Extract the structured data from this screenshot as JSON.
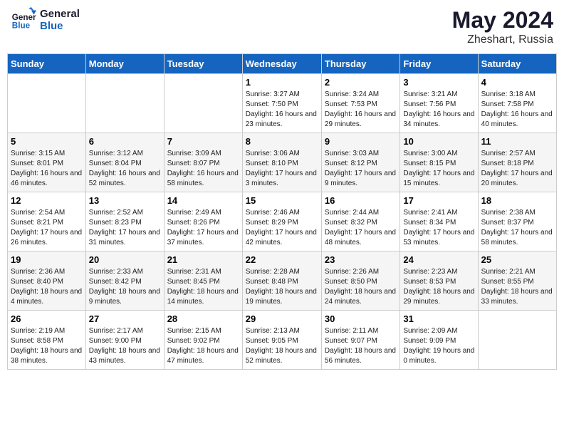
{
  "header": {
    "logo_line1": "General",
    "logo_line2": "Blue",
    "month": "May 2024",
    "location": "Zheshart, Russia"
  },
  "weekdays": [
    "Sunday",
    "Monday",
    "Tuesday",
    "Wednesday",
    "Thursday",
    "Friday",
    "Saturday"
  ],
  "weeks": [
    [
      {
        "day": "",
        "sunrise": "",
        "sunset": "",
        "daylight": ""
      },
      {
        "day": "",
        "sunrise": "",
        "sunset": "",
        "daylight": ""
      },
      {
        "day": "",
        "sunrise": "",
        "sunset": "",
        "daylight": ""
      },
      {
        "day": "1",
        "sunrise": "Sunrise: 3:27 AM",
        "sunset": "Sunset: 7:50 PM",
        "daylight": "Daylight: 16 hours and 23 minutes."
      },
      {
        "day": "2",
        "sunrise": "Sunrise: 3:24 AM",
        "sunset": "Sunset: 7:53 PM",
        "daylight": "Daylight: 16 hours and 29 minutes."
      },
      {
        "day": "3",
        "sunrise": "Sunrise: 3:21 AM",
        "sunset": "Sunset: 7:56 PM",
        "daylight": "Daylight: 16 hours and 34 minutes."
      },
      {
        "day": "4",
        "sunrise": "Sunrise: 3:18 AM",
        "sunset": "Sunset: 7:58 PM",
        "daylight": "Daylight: 16 hours and 40 minutes."
      }
    ],
    [
      {
        "day": "5",
        "sunrise": "Sunrise: 3:15 AM",
        "sunset": "Sunset: 8:01 PM",
        "daylight": "Daylight: 16 hours and 46 minutes."
      },
      {
        "day": "6",
        "sunrise": "Sunrise: 3:12 AM",
        "sunset": "Sunset: 8:04 PM",
        "daylight": "Daylight: 16 hours and 52 minutes."
      },
      {
        "day": "7",
        "sunrise": "Sunrise: 3:09 AM",
        "sunset": "Sunset: 8:07 PM",
        "daylight": "Daylight: 16 hours and 58 minutes."
      },
      {
        "day": "8",
        "sunrise": "Sunrise: 3:06 AM",
        "sunset": "Sunset: 8:10 PM",
        "daylight": "Daylight: 17 hours and 3 minutes."
      },
      {
        "day": "9",
        "sunrise": "Sunrise: 3:03 AM",
        "sunset": "Sunset: 8:12 PM",
        "daylight": "Daylight: 17 hours and 9 minutes."
      },
      {
        "day": "10",
        "sunrise": "Sunrise: 3:00 AM",
        "sunset": "Sunset: 8:15 PM",
        "daylight": "Daylight: 17 hours and 15 minutes."
      },
      {
        "day": "11",
        "sunrise": "Sunrise: 2:57 AM",
        "sunset": "Sunset: 8:18 PM",
        "daylight": "Daylight: 17 hours and 20 minutes."
      }
    ],
    [
      {
        "day": "12",
        "sunrise": "Sunrise: 2:54 AM",
        "sunset": "Sunset: 8:21 PM",
        "daylight": "Daylight: 17 hours and 26 minutes."
      },
      {
        "day": "13",
        "sunrise": "Sunrise: 2:52 AM",
        "sunset": "Sunset: 8:23 PM",
        "daylight": "Daylight: 17 hours and 31 minutes."
      },
      {
        "day": "14",
        "sunrise": "Sunrise: 2:49 AM",
        "sunset": "Sunset: 8:26 PM",
        "daylight": "Daylight: 17 hours and 37 minutes."
      },
      {
        "day": "15",
        "sunrise": "Sunrise: 2:46 AM",
        "sunset": "Sunset: 8:29 PM",
        "daylight": "Daylight: 17 hours and 42 minutes."
      },
      {
        "day": "16",
        "sunrise": "Sunrise: 2:44 AM",
        "sunset": "Sunset: 8:32 PM",
        "daylight": "Daylight: 17 hours and 48 minutes."
      },
      {
        "day": "17",
        "sunrise": "Sunrise: 2:41 AM",
        "sunset": "Sunset: 8:34 PM",
        "daylight": "Daylight: 17 hours and 53 minutes."
      },
      {
        "day": "18",
        "sunrise": "Sunrise: 2:38 AM",
        "sunset": "Sunset: 8:37 PM",
        "daylight": "Daylight: 17 hours and 58 minutes."
      }
    ],
    [
      {
        "day": "19",
        "sunrise": "Sunrise: 2:36 AM",
        "sunset": "Sunset: 8:40 PM",
        "daylight": "Daylight: 18 hours and 4 minutes."
      },
      {
        "day": "20",
        "sunrise": "Sunrise: 2:33 AM",
        "sunset": "Sunset: 8:42 PM",
        "daylight": "Daylight: 18 hours and 9 minutes."
      },
      {
        "day": "21",
        "sunrise": "Sunrise: 2:31 AM",
        "sunset": "Sunset: 8:45 PM",
        "daylight": "Daylight: 18 hours and 14 minutes."
      },
      {
        "day": "22",
        "sunrise": "Sunrise: 2:28 AM",
        "sunset": "Sunset: 8:48 PM",
        "daylight": "Daylight: 18 hours and 19 minutes."
      },
      {
        "day": "23",
        "sunrise": "Sunrise: 2:26 AM",
        "sunset": "Sunset: 8:50 PM",
        "daylight": "Daylight: 18 hours and 24 minutes."
      },
      {
        "day": "24",
        "sunrise": "Sunrise: 2:23 AM",
        "sunset": "Sunset: 8:53 PM",
        "daylight": "Daylight: 18 hours and 29 minutes."
      },
      {
        "day": "25",
        "sunrise": "Sunrise: 2:21 AM",
        "sunset": "Sunset: 8:55 PM",
        "daylight": "Daylight: 18 hours and 33 minutes."
      }
    ],
    [
      {
        "day": "26",
        "sunrise": "Sunrise: 2:19 AM",
        "sunset": "Sunset: 8:58 PM",
        "daylight": "Daylight: 18 hours and 38 minutes."
      },
      {
        "day": "27",
        "sunrise": "Sunrise: 2:17 AM",
        "sunset": "Sunset: 9:00 PM",
        "daylight": "Daylight: 18 hours and 43 minutes."
      },
      {
        "day": "28",
        "sunrise": "Sunrise: 2:15 AM",
        "sunset": "Sunset: 9:02 PM",
        "daylight": "Daylight: 18 hours and 47 minutes."
      },
      {
        "day": "29",
        "sunrise": "Sunrise: 2:13 AM",
        "sunset": "Sunset: 9:05 PM",
        "daylight": "Daylight: 18 hours and 52 minutes."
      },
      {
        "day": "30",
        "sunrise": "Sunrise: 2:11 AM",
        "sunset": "Sunset: 9:07 PM",
        "daylight": "Daylight: 18 hours and 56 minutes."
      },
      {
        "day": "31",
        "sunrise": "Sunrise: 2:09 AM",
        "sunset": "Sunset: 9:09 PM",
        "daylight": "Daylight: 19 hours and 0 minutes."
      },
      {
        "day": "",
        "sunrise": "",
        "sunset": "",
        "daylight": ""
      }
    ]
  ]
}
